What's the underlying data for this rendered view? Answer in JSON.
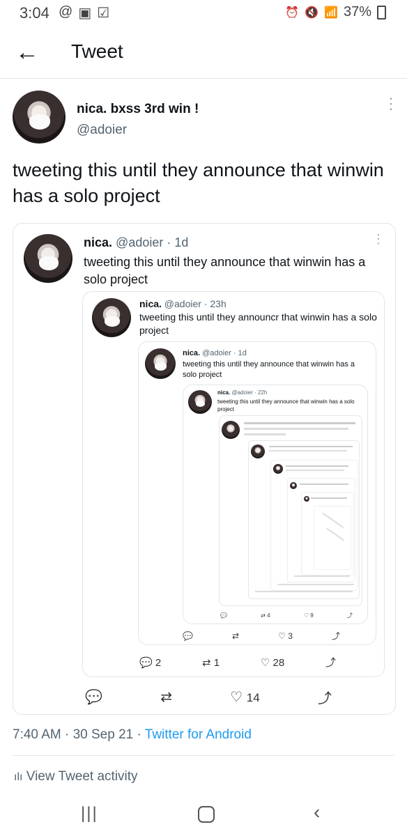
{
  "status": {
    "time": "3:04",
    "battery": "37%",
    "left_icons": [
      "@",
      "▣",
      "☑"
    ],
    "right_icons": [
      "⏰",
      "🔇",
      "📶"
    ]
  },
  "header": {
    "title": "Tweet"
  },
  "tweet": {
    "display_name": "nica. bxss 3rd win !",
    "handle": "@adoier",
    "text": "tweeting this until they announce that winwin has a solo project",
    "timestamp": "7:40 AM · 30 Sep 21 · ",
    "source": "Twitter for Android",
    "replies": "",
    "retweets": "",
    "likes": "14"
  },
  "quote1": {
    "name": "nica.",
    "handle_time": "@adoier · 1d",
    "text": "tweeting this until they announce that winwin has a solo project",
    "replies": "2",
    "retweets": "1",
    "likes": "28"
  },
  "quote2": {
    "name": "nica.",
    "handle_time": "@adoier · 23h",
    "text": "tweeting this until they announcr that winwin has a solo project",
    "likes": "3"
  },
  "quote3": {
    "name": "nica.",
    "handle_time": "@adoier · 1d",
    "text": "tweeting this until they announce that winwin has a solo project",
    "likes": "3"
  },
  "quote4": {
    "name": "nica.",
    "handle_time": "@adoier · 22h",
    "text": "tweeting this until they announce that winwin has a solo project",
    "retweets": "4",
    "likes": "9"
  },
  "activity": {
    "label": "View Tweet activity"
  },
  "colors": {
    "link": "#1d9bf0",
    "muted": "#536471",
    "border": "#e1e4e8"
  }
}
